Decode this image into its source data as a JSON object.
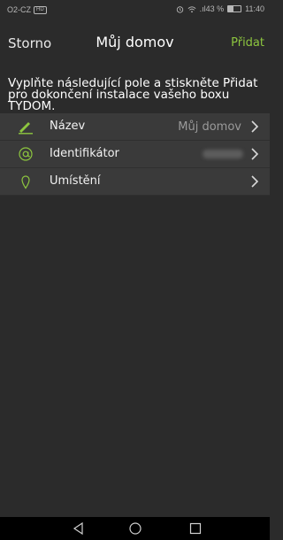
{
  "status_bar": {
    "carrier": "O2-CZ",
    "sim_badge": "HD",
    "signal_text": ".ıl43 %",
    "battery_level": 0.43,
    "time": "11:40"
  },
  "header": {
    "cancel_label": "Storno",
    "title": "Můj domov",
    "add_label": "Přidat"
  },
  "instructions": "Vyplňte následující pole a stiskněte Přidat pro dokončení instalace vašeho boxu TYDOM.",
  "form": {
    "rows": [
      {
        "icon": "pencil-icon",
        "label": "Název",
        "value": "Můj domov"
      },
      {
        "icon": "at-sign-icon",
        "label": "Identifikátor",
        "value": ""
      },
      {
        "icon": "location-pin-icon",
        "label": "Umístění",
        "value": ""
      }
    ]
  },
  "colors": {
    "accent": "#8dc63f",
    "background": "#2b2b2b",
    "row": "#3a3a3a"
  },
  "nav": {
    "icons": [
      "back-icon",
      "home-icon",
      "recents-icon"
    ]
  }
}
